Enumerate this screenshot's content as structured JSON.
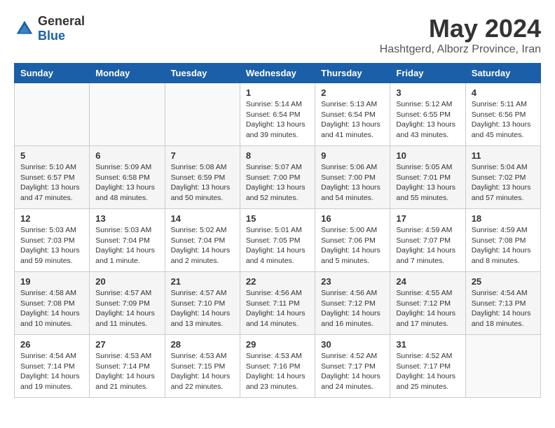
{
  "header": {
    "logo_general": "General",
    "logo_blue": "Blue",
    "month_year": "May 2024",
    "location": "Hashtgerd, Alborz Province, Iran"
  },
  "days_of_week": [
    "Sunday",
    "Monday",
    "Tuesday",
    "Wednesday",
    "Thursday",
    "Friday",
    "Saturday"
  ],
  "weeks": [
    [
      {
        "day": "",
        "content": ""
      },
      {
        "day": "",
        "content": ""
      },
      {
        "day": "",
        "content": ""
      },
      {
        "day": "1",
        "content": "Sunrise: 5:14 AM\nSunset: 6:54 PM\nDaylight: 13 hours\nand 39 minutes."
      },
      {
        "day": "2",
        "content": "Sunrise: 5:13 AM\nSunset: 6:54 PM\nDaylight: 13 hours\nand 41 minutes."
      },
      {
        "day": "3",
        "content": "Sunrise: 5:12 AM\nSunset: 6:55 PM\nDaylight: 13 hours\nand 43 minutes."
      },
      {
        "day": "4",
        "content": "Sunrise: 5:11 AM\nSunset: 6:56 PM\nDaylight: 13 hours\nand 45 minutes."
      }
    ],
    [
      {
        "day": "5",
        "content": "Sunrise: 5:10 AM\nSunset: 6:57 PM\nDaylight: 13 hours\nand 47 minutes."
      },
      {
        "day": "6",
        "content": "Sunrise: 5:09 AM\nSunset: 6:58 PM\nDaylight: 13 hours\nand 48 minutes."
      },
      {
        "day": "7",
        "content": "Sunrise: 5:08 AM\nSunset: 6:59 PM\nDaylight: 13 hours\nand 50 minutes."
      },
      {
        "day": "8",
        "content": "Sunrise: 5:07 AM\nSunset: 7:00 PM\nDaylight: 13 hours\nand 52 minutes."
      },
      {
        "day": "9",
        "content": "Sunrise: 5:06 AM\nSunset: 7:00 PM\nDaylight: 13 hours\nand 54 minutes."
      },
      {
        "day": "10",
        "content": "Sunrise: 5:05 AM\nSunset: 7:01 PM\nDaylight: 13 hours\nand 55 minutes."
      },
      {
        "day": "11",
        "content": "Sunrise: 5:04 AM\nSunset: 7:02 PM\nDaylight: 13 hours\nand 57 minutes."
      }
    ],
    [
      {
        "day": "12",
        "content": "Sunrise: 5:03 AM\nSunset: 7:03 PM\nDaylight: 13 hours\nand 59 minutes."
      },
      {
        "day": "13",
        "content": "Sunrise: 5:03 AM\nSunset: 7:04 PM\nDaylight: 14 hours\nand 1 minute."
      },
      {
        "day": "14",
        "content": "Sunrise: 5:02 AM\nSunset: 7:04 PM\nDaylight: 14 hours\nand 2 minutes."
      },
      {
        "day": "15",
        "content": "Sunrise: 5:01 AM\nSunset: 7:05 PM\nDaylight: 14 hours\nand 4 minutes."
      },
      {
        "day": "16",
        "content": "Sunrise: 5:00 AM\nSunset: 7:06 PM\nDaylight: 14 hours\nand 5 minutes."
      },
      {
        "day": "17",
        "content": "Sunrise: 4:59 AM\nSunset: 7:07 PM\nDaylight: 14 hours\nand 7 minutes."
      },
      {
        "day": "18",
        "content": "Sunrise: 4:59 AM\nSunset: 7:08 PM\nDaylight: 14 hours\nand 8 minutes."
      }
    ],
    [
      {
        "day": "19",
        "content": "Sunrise: 4:58 AM\nSunset: 7:08 PM\nDaylight: 14 hours\nand 10 minutes."
      },
      {
        "day": "20",
        "content": "Sunrise: 4:57 AM\nSunset: 7:09 PM\nDaylight: 14 hours\nand 11 minutes."
      },
      {
        "day": "21",
        "content": "Sunrise: 4:57 AM\nSunset: 7:10 PM\nDaylight: 14 hours\nand 13 minutes."
      },
      {
        "day": "22",
        "content": "Sunrise: 4:56 AM\nSunset: 7:11 PM\nDaylight: 14 hours\nand 14 minutes."
      },
      {
        "day": "23",
        "content": "Sunrise: 4:56 AM\nSunset: 7:12 PM\nDaylight: 14 hours\nand 16 minutes."
      },
      {
        "day": "24",
        "content": "Sunrise: 4:55 AM\nSunset: 7:12 PM\nDaylight: 14 hours\nand 17 minutes."
      },
      {
        "day": "25",
        "content": "Sunrise: 4:54 AM\nSunset: 7:13 PM\nDaylight: 14 hours\nand 18 minutes."
      }
    ],
    [
      {
        "day": "26",
        "content": "Sunrise: 4:54 AM\nSunset: 7:14 PM\nDaylight: 14 hours\nand 19 minutes."
      },
      {
        "day": "27",
        "content": "Sunrise: 4:53 AM\nSunset: 7:14 PM\nDaylight: 14 hours\nand 21 minutes."
      },
      {
        "day": "28",
        "content": "Sunrise: 4:53 AM\nSunset: 7:15 PM\nDaylight: 14 hours\nand 22 minutes."
      },
      {
        "day": "29",
        "content": "Sunrise: 4:53 AM\nSunset: 7:16 PM\nDaylight: 14 hours\nand 23 minutes."
      },
      {
        "day": "30",
        "content": "Sunrise: 4:52 AM\nSunset: 7:17 PM\nDaylight: 14 hours\nand 24 minutes."
      },
      {
        "day": "31",
        "content": "Sunrise: 4:52 AM\nSunset: 7:17 PM\nDaylight: 14 hours\nand 25 minutes."
      },
      {
        "day": "",
        "content": ""
      }
    ]
  ]
}
